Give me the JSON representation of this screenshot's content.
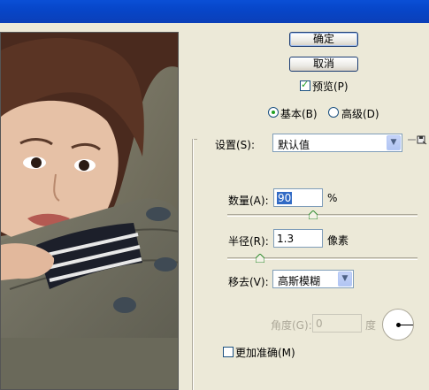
{
  "buttons": {
    "ok": "确定",
    "cancel": "取消"
  },
  "preview_toggle": {
    "label": "预览(P)",
    "checked": true
  },
  "mode": {
    "basic": "基本(B)",
    "advanced": "高级(D)",
    "selected": "basic"
  },
  "settings": {
    "label": "设置(S):",
    "value": "默认值"
  },
  "amount": {
    "label": "数量(A):",
    "value": "90",
    "unit": "%",
    "slider_fraction": 0.45
  },
  "radius": {
    "label": "半径(R):",
    "value": "1.3",
    "unit": "像素",
    "slider_fraction": 0.17
  },
  "remove": {
    "label": "移去(V):",
    "value": "高斯模糊"
  },
  "angle": {
    "label": "角度(G):",
    "value": "0",
    "unit": "度"
  },
  "more_accurate": {
    "label": "更加准确(M)",
    "checked": false
  },
  "icons": {
    "dropdown": "chevron-down-icon",
    "settings_menu": "save-settings-icon"
  }
}
